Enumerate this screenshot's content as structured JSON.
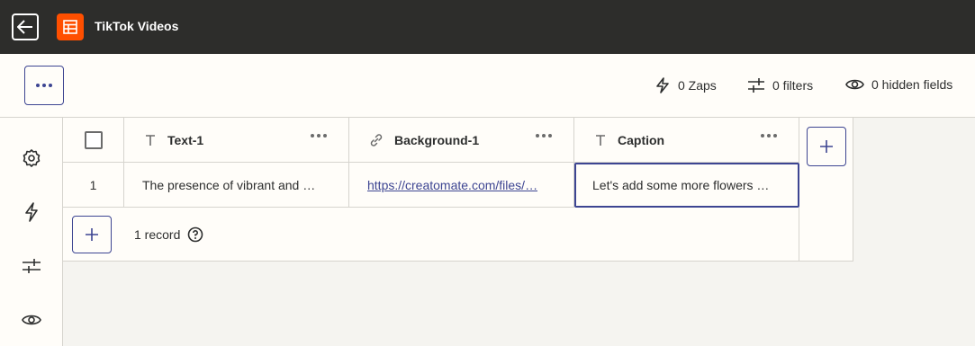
{
  "header": {
    "title": "TikTok Videos"
  },
  "toolbar": {
    "zaps_label": "0 Zaps",
    "filters_label": "0 filters",
    "hidden_fields_label": "0 hidden fields"
  },
  "table": {
    "columns": [
      {
        "label": "Text-1",
        "icon": "text-icon"
      },
      {
        "label": "Background-1",
        "icon": "link-icon"
      },
      {
        "label": "Caption",
        "icon": "text-icon"
      }
    ],
    "rows": [
      {
        "number": "1",
        "cells": [
          "The presence of vibrant and …",
          "https://creatomate.com/files/…",
          "Let's add some more flowers …"
        ]
      }
    ],
    "record_count": "1 record"
  },
  "colors": {
    "topbar_bg": "#2d2d2b",
    "brand_orange": "#ff4f00",
    "accent": "#3d4592"
  }
}
